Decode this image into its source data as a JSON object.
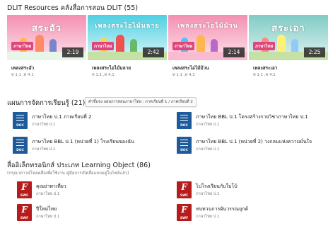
{
  "resources_section": {
    "title": "DLIT Resources คลังสื่อการสอน DLIT (55)",
    "videos": [
      {
        "thumb_title": "สระอัว",
        "badge": "ภาษาไทย",
        "duration": "2:19",
        "name": "เพลงสระอัว",
        "meta": "ท 1.1 ,ท 4.1",
        "bg_top": "#f48fb1",
        "bg_bottom": "#fce4ec",
        "ground": "#e8f5e9"
      },
      {
        "thumb_title": "เพลงสระไอไม้มลาย",
        "badge": "ภาษาไทย",
        "duration": "2:42",
        "name": "เพลงสระไอไม้มลาย",
        "meta": "ท 1.1 ,ท 4.1",
        "bg_top": "#4dd0e1",
        "bg_bottom": "#e0f7fa",
        "ground": "#c5e1a5"
      },
      {
        "thumb_title": "เพลงสระไอไม้ม้วน",
        "badge": "ภาษาไทย",
        "duration": "2:14",
        "name": "เพลงสระไอไม้ม้วน",
        "meta": "ท 1.1 ,ท 4.1",
        "bg_top": "#f48fb1",
        "bg_bottom": "#fce4ec",
        "ground": "#f8bbd0"
      },
      {
        "thumb_title": "สระเอา",
        "badge": "ภาษาไทย",
        "duration": "2:25",
        "name": "เพลงสระเอา",
        "meta": "ท 1.1 ,ท 4.1",
        "bg_top": "#80cbc4",
        "bg_bottom": "#e0f2f1",
        "ground": "#c5e1a5"
      }
    ]
  },
  "plans_section": {
    "title": "แผนการจัดการเรียนรู้ (21)",
    "hint": "คำชี้แจง แผนการสอนภาษาไทย : ภาคเรียนที่ 1 / ภาคเรียนที่ 2",
    "docs": [
      {
        "name": "ภาษาไทย ป.1 ภาคเรียนที่ 2",
        "meta": "ภาษาไทย ป.1",
        "ext": "DOC"
      },
      {
        "name": "ภาษาไทย BBL ป.1 โครงสร้างรายวิชาภาษาไทย ป.1",
        "meta": "ภาษาไทย ป.1",
        "ext": "DOC"
      },
      {
        "name": "ภาษาไทย BBL ป.1 (หน่วยที่ 1) โรงเรียนของฉัน",
        "meta": "ภาษาไทย ป.1",
        "ext": "DOC"
      },
      {
        "name": "ภาษาไทย BBL ป.1 (หน่วยที่ 2) วงกลมแห่งความมั่นใจ",
        "meta": "ภาษาไทย ป.1",
        "ext": "DOC"
      }
    ]
  },
  "lo_section": {
    "title": "สื่ออิเล็กทรอนิกส์ ประเภท Learning Object (86)",
    "subtitle": "(กรุณาดาวน์โหลดสื่อเพื่อใช้งาน คู่มือการเปิดสื่อแบบอยู่ในไฟล์แล้ว)",
    "items": [
      {
        "name": "คุณย่าพาเที่ยว",
        "meta": "ภาษาไทย ป.1",
        "ext": "SWF",
        "icon": "F"
      },
      {
        "name": "ไปโรงเรียนกับใบโบ้",
        "meta": "ภาษาไทย ป.1",
        "ext": "SWF",
        "icon": "F"
      },
      {
        "name": "ปีใหม่ไทย",
        "meta": "ภาษาไทย ป.1",
        "ext": "SWF",
        "icon": "F"
      },
      {
        "name": "ทบทวนการผันวรรณยุกต์",
        "meta": "ภาษาไทย ป.1",
        "ext": "SWF",
        "icon": "F"
      }
    ]
  }
}
